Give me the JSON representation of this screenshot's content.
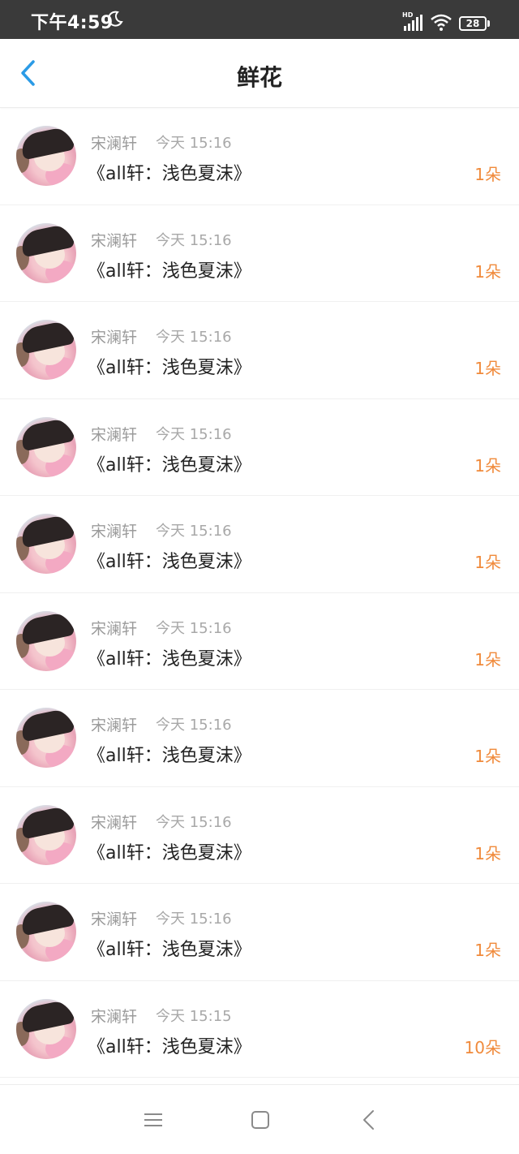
{
  "status_bar": {
    "time": "下午4:59",
    "hd_label": "HD",
    "battery": "28",
    "icons": [
      "moon-icon",
      "signal-icon",
      "wifi-icon",
      "battery-icon"
    ]
  },
  "header": {
    "title": "鲜花",
    "back_icon": "chevron-left-icon"
  },
  "colors": {
    "accent_blue": "#2b9be6",
    "count_orange": "#f08a3b",
    "status_bar_bg": "#3a3a3a",
    "title_text": "#222222",
    "meta_text": "#9b9b9b"
  },
  "items": [
    {
      "name": "宋澜轩",
      "time": "今天 15:16",
      "title": "《all轩：浅色夏沫》",
      "count": "1朵"
    },
    {
      "name": "宋澜轩",
      "time": "今天 15:16",
      "title": "《all轩：浅色夏沫》",
      "count": "1朵"
    },
    {
      "name": "宋澜轩",
      "time": "今天 15:16",
      "title": "《all轩：浅色夏沫》",
      "count": "1朵"
    },
    {
      "name": "宋澜轩",
      "time": "今天 15:16",
      "title": "《all轩：浅色夏沫》",
      "count": "1朵"
    },
    {
      "name": "宋澜轩",
      "time": "今天 15:16",
      "title": "《all轩：浅色夏沫》",
      "count": "1朵"
    },
    {
      "name": "宋澜轩",
      "time": "今天 15:16",
      "title": "《all轩：浅色夏沫》",
      "count": "1朵"
    },
    {
      "name": "宋澜轩",
      "time": "今天 15:16",
      "title": "《all轩：浅色夏沫》",
      "count": "1朵"
    },
    {
      "name": "宋澜轩",
      "time": "今天 15:16",
      "title": "《all轩：浅色夏沫》",
      "count": "1朵"
    },
    {
      "name": "宋澜轩",
      "time": "今天 15:16",
      "title": "《all轩：浅色夏沫》",
      "count": "1朵"
    },
    {
      "name": "宋澜轩",
      "time": "今天 15:15",
      "title": "《all轩：浅色夏沫》",
      "count": "10朵"
    }
  ],
  "nav_bar": {
    "buttons": [
      "menu-icon",
      "home-square-icon",
      "back-triangle-icon"
    ]
  }
}
